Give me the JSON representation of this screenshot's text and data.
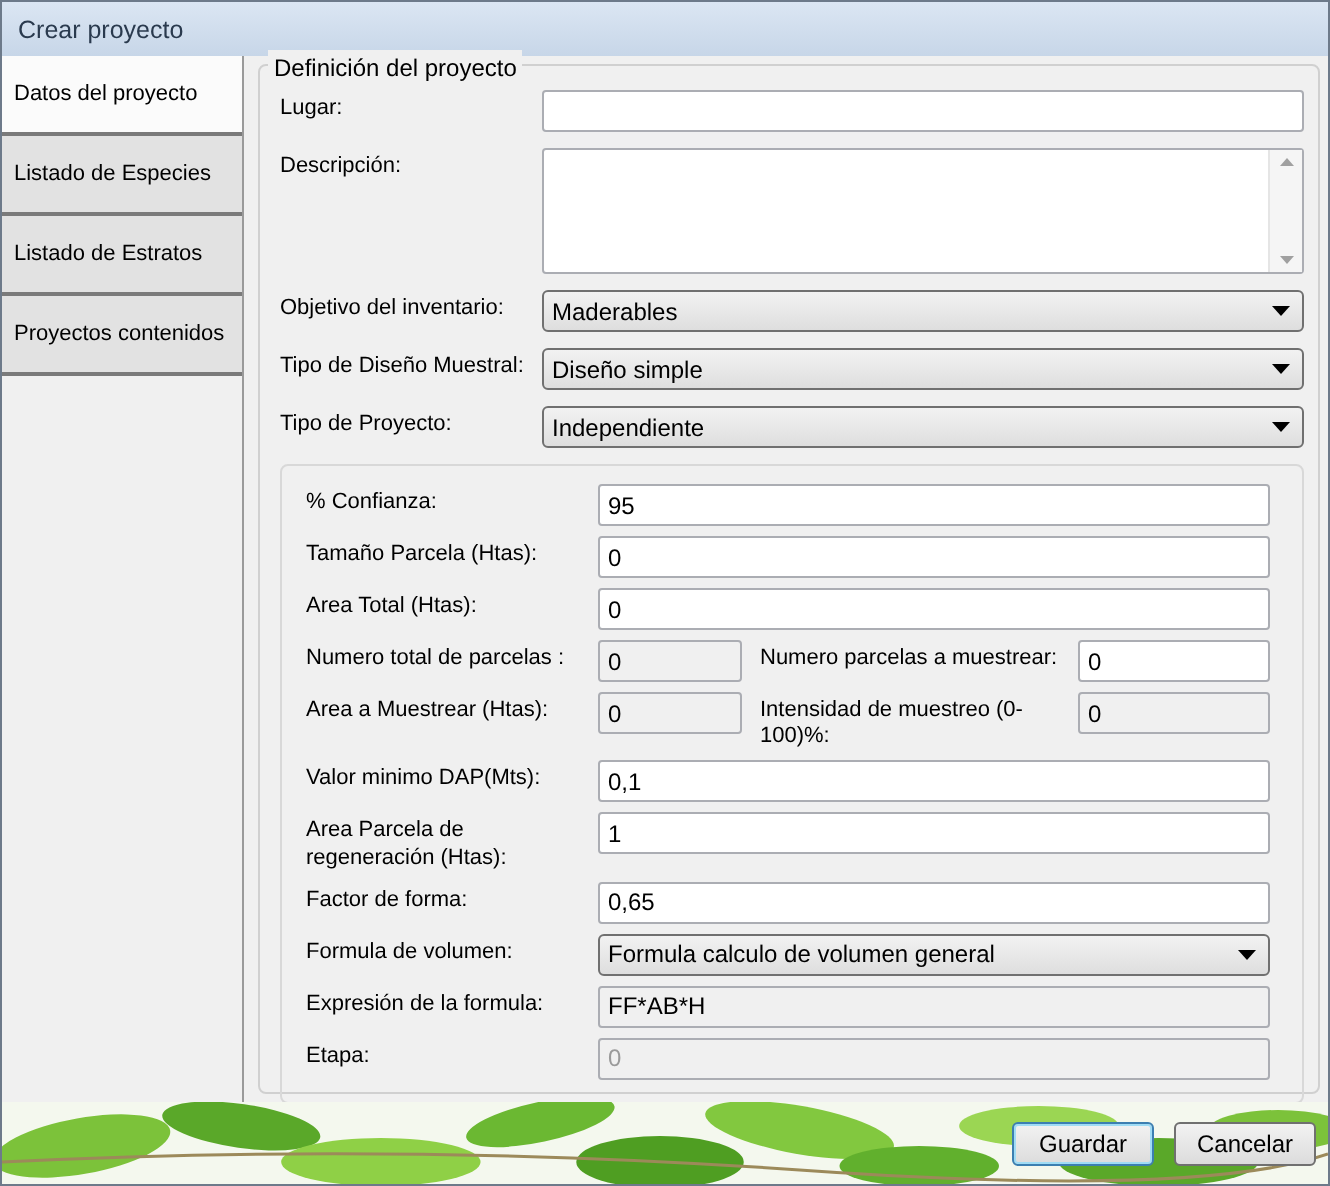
{
  "window": {
    "title": "Crear proyecto"
  },
  "sidebar": {
    "items": [
      {
        "label": "Datos del proyecto",
        "selected": true
      },
      {
        "label": "Listado de Especies",
        "selected": false
      },
      {
        "label": "Listado de Estratos",
        "selected": false
      },
      {
        "label": "Proyectos contenidos",
        "selected": false
      }
    ]
  },
  "definition": {
    "title": "Definición del proyecto",
    "fields": [
      {
        "kind": "text",
        "label": "Lugar:"
      },
      {
        "kind": "textarea",
        "label": "Descripción:"
      },
      {
        "kind": "select",
        "label": "Objetivo del inventario:",
        "value": "Maderables"
      },
      {
        "kind": "select",
        "label": "Tipo de Diseño Muestral:",
        "value": "Diseño simple"
      },
      {
        "kind": "select",
        "label": "Tipo de Proyecto:",
        "value": "Independiente"
      }
    ]
  },
  "parameters": {
    "rows": [
      {
        "kind": "text",
        "label": "% Confianza:",
        "value": "95",
        "readonly": false,
        "disabled": false
      },
      {
        "kind": "text",
        "label": "Tamaño Parcela (Htas):",
        "value": "0",
        "readonly": false,
        "disabled": false
      },
      {
        "kind": "text",
        "label": "Area Total (Htas):",
        "value": "0",
        "readonly": false,
        "disabled": false
      },
      {
        "kind": "pair",
        "cells": [
          {
            "label": "Numero total de parcelas :",
            "value": "0",
            "readonly": true
          },
          {
            "label": "Numero parcelas a muestrear:",
            "value": "0",
            "readonly": false
          }
        ]
      },
      {
        "kind": "pair",
        "cells": [
          {
            "label": "Area a Muestrear (Htas):",
            "value": "0",
            "readonly": true
          },
          {
            "label": "Intensidad de muestreo (0-100)%:",
            "value": "0",
            "readonly": true
          }
        ]
      },
      {
        "kind": "text",
        "label": "Valor minimo DAP(Mts):",
        "value": "0,1",
        "readonly": false,
        "disabled": false
      },
      {
        "kind": "text",
        "label": "Area Parcela de regeneración (Htas):",
        "value": "1",
        "readonly": false,
        "disabled": false
      },
      {
        "kind": "text",
        "label": "Factor de forma:",
        "value": "0,65",
        "readonly": false,
        "disabled": false
      },
      {
        "kind": "select",
        "label": "Formula de volumen:",
        "value": "Formula calculo de volumen general"
      },
      {
        "kind": "text",
        "label": "Expresión de la formula:",
        "value": "FF*AB*H",
        "readonly": true,
        "disabled": false
      },
      {
        "kind": "text",
        "label": "Etapa:",
        "value": "0",
        "readonly": true,
        "disabled": true
      }
    ]
  },
  "footer": {
    "buttons": [
      {
        "label": "Guardar",
        "default": true
      },
      {
        "label": "Cancelar",
        "default": false
      }
    ]
  }
}
